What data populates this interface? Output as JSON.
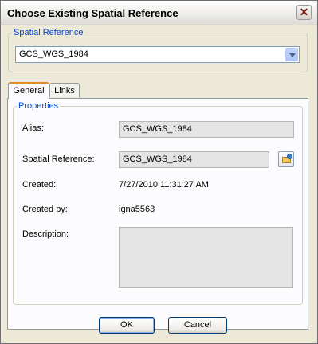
{
  "window": {
    "title": "Choose Existing Spatial Reference"
  },
  "spatial_reference_group": {
    "legend": "Spatial Reference",
    "selected": "GCS_WGS_1984"
  },
  "tabs": [
    {
      "label": "General",
      "active": true
    },
    {
      "label": "Links",
      "active": false
    }
  ],
  "properties": {
    "legend": "Properties",
    "alias_label": "Alias:",
    "alias_value": "GCS_WGS_1984",
    "spatial_reference_label": "Spatial Reference:",
    "spatial_reference_value": "GCS_WGS_1984",
    "created_label": "Created:",
    "created_value": "7/27/2010 11:31:27 AM",
    "created_by_label": "Created by:",
    "created_by_value": "igna5563",
    "description_label": "Description:",
    "description_value": ""
  },
  "buttons": {
    "ok": "OK",
    "cancel": "Cancel"
  },
  "icons": {
    "close": "close-icon",
    "dropdown": "chevron-down-icon",
    "spatial_reference_properties": "folder-globe-icon"
  },
  "colors": {
    "legend_text": "#0046d5",
    "active_tab_accent": "#e68b2c",
    "button_border": "#003c74"
  }
}
